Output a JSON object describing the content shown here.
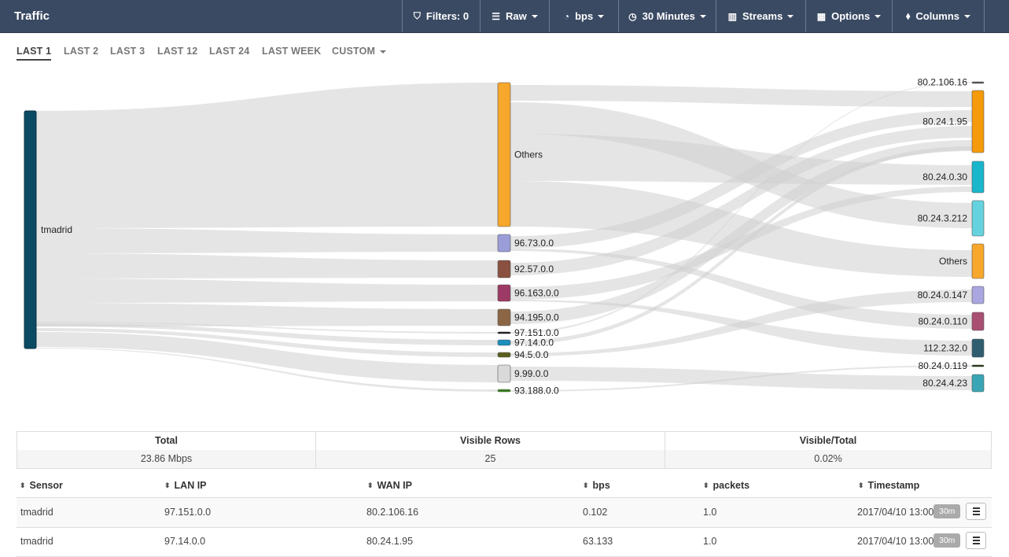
{
  "header": {
    "title": "Traffic",
    "toolbar": [
      {
        "label": "Filters: 0",
        "icon": "filter-icon",
        "glyph": "⛉",
        "caret": false
      },
      {
        "label": "Raw",
        "icon": "list-icon",
        "glyph": "☰",
        "caret": true
      },
      {
        "label": "bps",
        "icon": "gauge-icon",
        "glyph": "◔",
        "caret": true
      },
      {
        "label": "30 Minutes",
        "icon": "clock-icon",
        "glyph": "◷",
        "caret": true
      },
      {
        "label": "Streams",
        "icon": "bar-chart-icon",
        "glyph": "▥",
        "caret": true
      },
      {
        "label": "Options",
        "icon": "grid-icon",
        "glyph": "▦",
        "caret": true
      },
      {
        "label": "Columns",
        "icon": "tags-icon",
        "glyph": "⬧",
        "caret": true
      }
    ]
  },
  "time_tabs": {
    "items": [
      "LAST 1",
      "LAST 2",
      "LAST 3",
      "LAST 12",
      "LAST 24",
      "LAST WEEK",
      "CUSTOM"
    ],
    "active": "LAST 1"
  },
  "sankey": {
    "sensors": [
      {
        "label": "tmadrid",
        "color": "#0b4a63"
      }
    ],
    "lan": [
      {
        "label": "Others",
        "color": "#f7a72c"
      },
      {
        "label": "96.73.0.0",
        "color": "#9a9dd8"
      },
      {
        "label": "92.57.0.0",
        "color": "#8a5040"
      },
      {
        "label": "96.163.0.0",
        "color": "#9c3a65"
      },
      {
        "label": "94.195.0.0",
        "color": "#8c6644"
      },
      {
        "label": "97.151.0.0",
        "color": "#222222"
      },
      {
        "label": "97.14.0.0",
        "color": "#1a8fbf"
      },
      {
        "label": "94.5.0.0",
        "color": "#5a5f1e"
      },
      {
        "label": "9.99.0.0",
        "color": "#d9d9d9"
      },
      {
        "label": "93.188.0.0",
        "color": "#3d7a2a"
      }
    ],
    "wan": [
      {
        "label": "80.2.106.16",
        "color": "#555555"
      },
      {
        "label": "80.24.1.95",
        "color": "#f59a0b"
      },
      {
        "label": "80.24.0.30",
        "color": "#1ab6cc"
      },
      {
        "label": "80.24.3.212",
        "color": "#64d3de"
      },
      {
        "label": "Others",
        "color": "#f7a72c"
      },
      {
        "label": "80.24.0.147",
        "color": "#a9a6e0"
      },
      {
        "label": "80.24.0.110",
        "color": "#a84f72"
      },
      {
        "label": "112.2.32.0",
        "color": "#2f5d6f"
      },
      {
        "label": "80.24.0.119",
        "color": "#2b3a1e"
      },
      {
        "label": "80.24.4.23",
        "color": "#3aa6b5"
      }
    ]
  },
  "summary": {
    "headers": [
      "Total",
      "Visible Rows",
      "Visible/Total"
    ],
    "values": [
      "23.86 Mbps",
      "25",
      "0.02%"
    ]
  },
  "table": {
    "columns": [
      "Sensor",
      "LAN IP",
      "WAN IP",
      "bps",
      "packets",
      "Timestamp"
    ],
    "rows": [
      {
        "sensor": "tmadrid",
        "lan_ip": "97.151.0.0",
        "wan_ip": "80.2.106.16",
        "bps": "0.102",
        "packets": "1.0",
        "timestamp": "2017/04/10 13:00",
        "badge": "30m"
      },
      {
        "sensor": "tmadrid",
        "lan_ip": "97.14.0.0",
        "wan_ip": "80.24.1.95",
        "bps": "63.133",
        "packets": "1.0",
        "timestamp": "2017/04/10 13:00",
        "badge": "30m"
      }
    ]
  }
}
